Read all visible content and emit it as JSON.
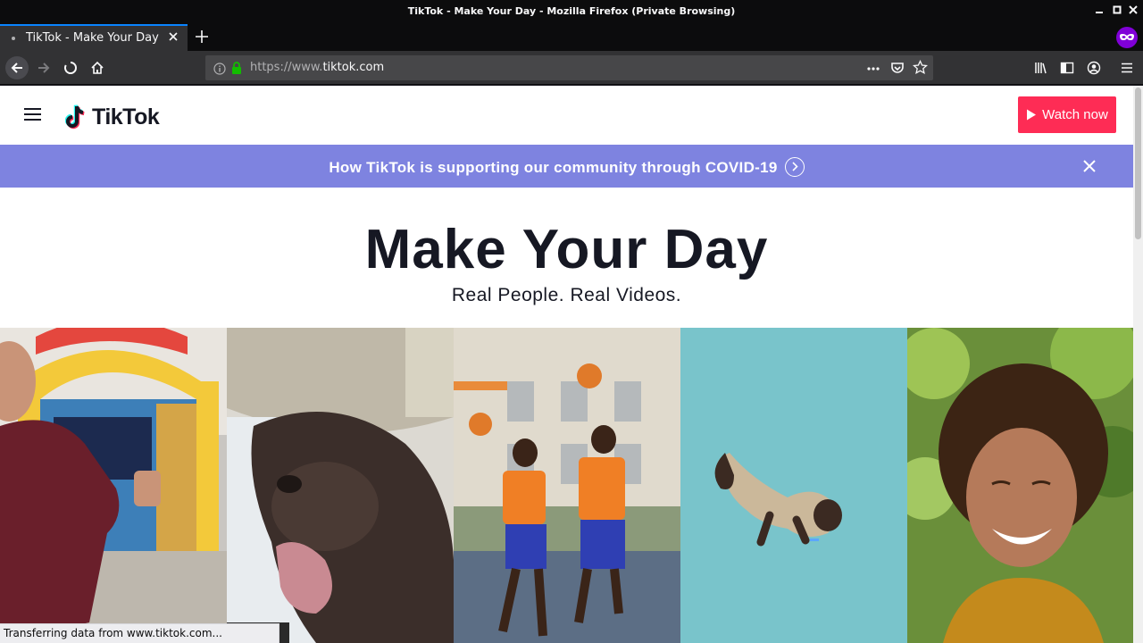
{
  "window": {
    "title": "TikTok - Make Your Day - Mozilla Firefox (Private Browsing)"
  },
  "tabs": [
    {
      "label": "TikTok - Make Your Day"
    }
  ],
  "urlbar": {
    "prefix": "https://www.",
    "domain": "tiktok.com"
  },
  "site": {
    "logo_text": "TikTok",
    "watch_button": "Watch now",
    "banner_text": "How TikTok is supporting our community through COVID-19",
    "hero_title": "Make Your Day",
    "hero_subtitle": "Real People. Real Videos."
  },
  "status_text": "Transferring data from www.tiktok.com...",
  "colors": {
    "brand_red": "#fe2c55",
    "banner_purple": "#7e83e0",
    "text_dark": "#161823"
  },
  "icons": [
    "back-arrow-icon",
    "forward-arrow-icon",
    "stop-loading-icon",
    "home-icon",
    "info-icon",
    "lock-icon",
    "page-actions-icon",
    "pocket-icon",
    "bookmark-star-icon",
    "library-icon",
    "sidebar-icon",
    "account-icon",
    "menu-icon",
    "private-browsing-mask-icon",
    "tiktok-note-icon",
    "play-icon",
    "chevron-circle-right-icon",
    "close-icon"
  ]
}
